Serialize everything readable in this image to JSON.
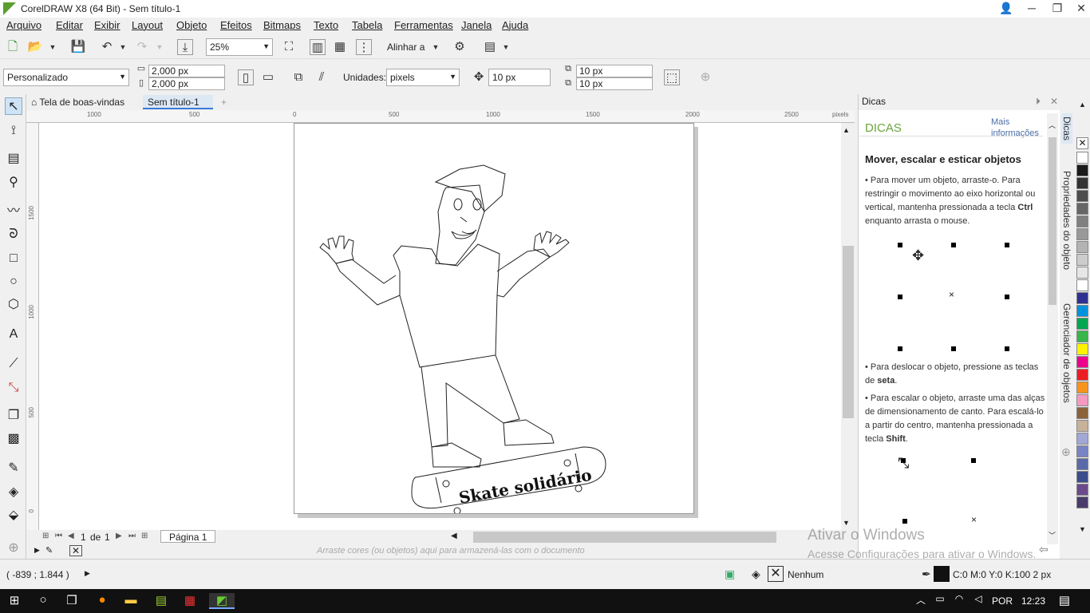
{
  "window": {
    "title": "CorelDRAW X8 (64 Bit) - Sem título-1"
  },
  "menu": [
    "Arquivo",
    "Editar",
    "Exibir",
    "Layout",
    "Objeto",
    "Efeitos",
    "Bitmaps",
    "Texto",
    "Tabela",
    "Ferramentas",
    "Janela",
    "Ajuda"
  ],
  "toolbar": {
    "zoom": "25%",
    "align_label": "Alinhar a"
  },
  "propbar": {
    "preset": "Personalizado",
    "width": "2,000 px",
    "height": "2,000 px",
    "units_label": "Unidades:",
    "units": "pixels",
    "nudge": "10 px",
    "dup_x": "10 px",
    "dup_y": "10 px"
  },
  "tabs": {
    "welcome": "Tela de boas-vindas",
    "doc": "Sem título-1"
  },
  "ruler_h": [
    "1000",
    "500",
    "0",
    "500",
    "1000",
    "1500",
    "2000",
    "2500",
    "pixels"
  ],
  "ruler_v": [
    "1500",
    "1000",
    "500",
    "0"
  ],
  "artwork": {
    "skate_text": "Skate solidário"
  },
  "pages": {
    "current": "1",
    "of": "de",
    "total": "1",
    "page_tab": "Página 1"
  },
  "colorwell_hint": "Arraste cores (ou objetos) aqui para armazená-las com o documento",
  "watermark": {
    "line1": "Ativar o Windows",
    "line2": "Acesse Configurações para ativar o Windows."
  },
  "docker": {
    "header": "Dicas",
    "title": "DICAS",
    "more": "Mais informações",
    "heading": "Mover, escalar e esticar objetos",
    "p1a": "Para mover um objeto, arraste-o. Para restringir o movimento ao eixo horizontal ou vertical, mantenha pressionada a tecla ",
    "p1b": "Ctrl",
    "p1c": " enquanto arrasta o mouse.",
    "p2a": "Para deslocar o objeto, pressione as teclas de ",
    "p2b": "seta",
    "p2c": ".",
    "p3a": "Para escalar o objeto, arraste uma das alças de dimensionamento de canto. Para escalá-lo a partir do centro, mantenha pressionada a tecla ",
    "p3b": "Shift",
    "p3c": "."
  },
  "side_tabs": [
    "Dicas",
    "Propriedades do objeto",
    "Gerenciador de objetos"
  ],
  "palette_colors": [
    "#ffffff",
    "#1a1a1a",
    "#333333",
    "#4d4d4d",
    "#666666",
    "#808080",
    "#999999",
    "#b3b3b3",
    "#cccccc",
    "#e6e6e6",
    "#ffffff",
    "#2e3192",
    "#0093dd",
    "#00a651",
    "#39b54a",
    "#fff200",
    "#ec008c",
    "#ed1c24",
    "#f7941d",
    "#f49ac1",
    "#8c6239",
    "#c7b299",
    "#a3a7d6",
    "#7884c4",
    "#5a6aa8",
    "#3c4d8c",
    "#6b4a8c",
    "#4a3b6b"
  ],
  "status": {
    "coords": "( -839 ; 1.844  )",
    "fill": "Nenhum",
    "outline": "C:0 M:0 Y:0 K:100  2 px"
  },
  "tray": {
    "lang": "POR",
    "time": "12:23"
  }
}
